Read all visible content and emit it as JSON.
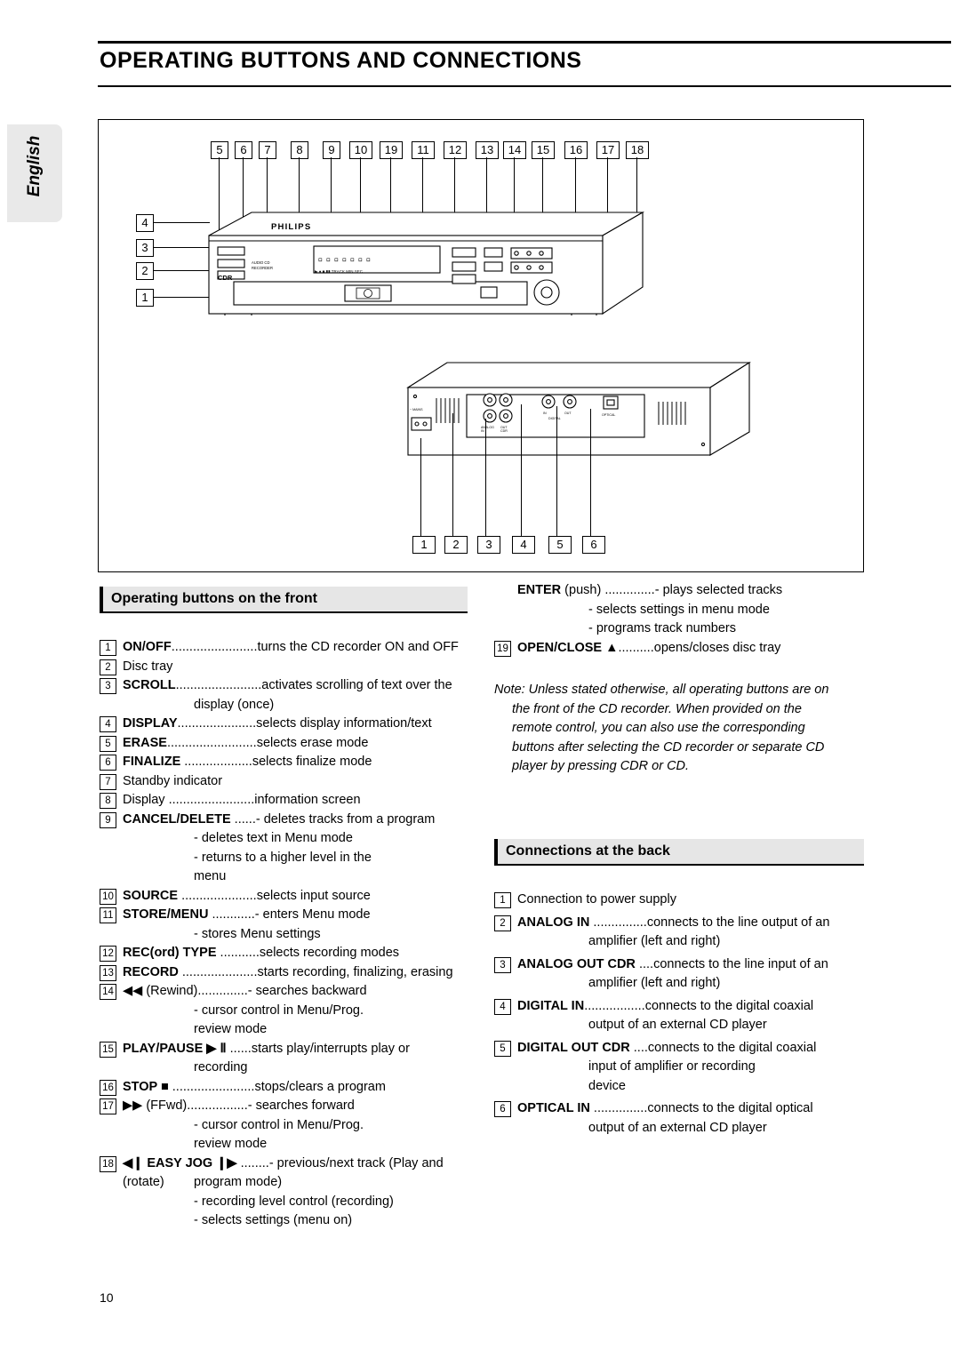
{
  "page": {
    "title": "OPERATING BUTTONS AND CONNECTIONS",
    "language_tab": "English",
    "page_number": "10"
  },
  "figure": {
    "top_callouts": [
      "5",
      "6",
      "7",
      "8",
      "9",
      "10",
      "19",
      "11",
      "12",
      "13",
      "14",
      "15",
      "16",
      "17",
      "18"
    ],
    "left_callouts": [
      "4",
      "3",
      "2",
      "1"
    ],
    "bottom_callouts": [
      "1",
      "2",
      "3",
      "4",
      "5",
      "6"
    ],
    "brand": "PHILIPS",
    "device_label": "CDR",
    "device_sub": "AUDIO CD RECORDER",
    "disc_logo": "COMPACT disc",
    "rear_labels": {
      "mains": "~ MAINS",
      "analog_in": "ANALOG IN",
      "analog_out": "ANALOG OUT CDR",
      "digital": "DIGITAL",
      "optical": "OPTICAL"
    }
  },
  "sections": {
    "front": "Operating buttons on the front",
    "back": "Connections at the back"
  },
  "front_items": [
    {
      "num": "1",
      "label": "ON/OFF",
      "dots": "........................",
      "desc": "turns the CD recorder ON and OFF",
      "subs": []
    },
    {
      "num": "2",
      "label": "",
      "dots": "",
      "desc": "Disc tray",
      "subs": []
    },
    {
      "num": "3",
      "label": "SCROLL",
      "dots": "........................",
      "desc": "activates scrolling of text over the",
      "subs": [
        "display (once)"
      ]
    },
    {
      "num": "4",
      "label": "DISPLAY",
      "dots": "......................",
      "desc": "selects display information/text",
      "subs": []
    },
    {
      "num": "5",
      "label": "ERASE",
      "dots": ".........................",
      "desc": "selects erase mode",
      "subs": []
    },
    {
      "num": "6",
      "label": "FINALIZE",
      "dots": "  ...................",
      "desc": "selects finalize mode",
      "subs": []
    },
    {
      "num": "7",
      "label": "",
      "dots": "",
      "desc": "Standby indicator",
      "subs": []
    },
    {
      "num": "8",
      "label": "",
      "dots": "",
      "desc": "Display ........................information screen",
      "subs": []
    },
    {
      "num": "9",
      "label": "CANCEL/DELETE",
      "dots": "  ......",
      "desc": "- deletes tracks from a program",
      "subs": [
        "- deletes text in Menu mode",
        "- returns to a higher level in the",
        "menu"
      ]
    },
    {
      "num": "10",
      "label": "SOURCE",
      "dots": "  .....................",
      "desc": "selects input source",
      "subs": []
    },
    {
      "num": "11",
      "label": "STORE/MENU",
      "dots": "  ............",
      "desc": "- enters Menu mode",
      "subs": [
        "- stores Menu settings"
      ]
    },
    {
      "num": "12",
      "label": "REC(ord) TYPE",
      "dots": "  ...........",
      "desc": "selects recording modes",
      "subs": []
    },
    {
      "num": "13",
      "label": "RECORD",
      "dots": "  .....................",
      "desc": "starts recording, finalizing, erasing",
      "subs": []
    },
    {
      "num": "14",
      "label": "◀◀ (Rewind)",
      "dots": "..............",
      "desc": "- searches backward",
      "subs": [
        "- cursor control in Menu/Prog.",
        "review mode"
      ]
    },
    {
      "num": "15",
      "label": "PLAY/PAUSE ▶ Ⅱ",
      "dots": "  ......",
      "desc": "starts play/interrupts play or",
      "subs": [
        "recording"
      ]
    },
    {
      "num": "16",
      "label": "STOP ■",
      "dots": "  .......................",
      "desc": "stops/clears a program",
      "subs": []
    },
    {
      "num": "17",
      "label": "▶▶ (FFwd)",
      "dots": ".................",
      "desc": "- searches forward",
      "subs": [
        "- cursor control in Menu/Prog.",
        "review mode"
      ]
    },
    {
      "num": "18",
      "label": "◀❙ EASY JOG ❙▶",
      "dots": "  ........",
      "desc": "- previous/next track (Play and",
      "subs": [
        "(rotate)",
        "program mode)",
        "- recording level control (recording)",
        "- selects settings (menu on)"
      ]
    }
  ],
  "front_items_right": [
    {
      "num": "",
      "label": "ENTER",
      "plain": " (push) ..............",
      "desc": "- plays selected tracks",
      "subs": [
        "- selects settings in menu mode",
        "- programs track numbers"
      ]
    },
    {
      "num": "19",
      "label": "OPEN/CLOSE ▲",
      "dots": "..........",
      "desc": "opens/closes disc tray",
      "subs": []
    }
  ],
  "note": {
    "line1": "Note: Unless stated otherwise, all operating buttons are on",
    "lines": [
      "the front of the CD recorder. When provided on the",
      "remote control, you can also use the corresponding",
      "buttons after selecting the CD recorder or separate CD",
      "player by pressing CDR or CD."
    ]
  },
  "back_items": [
    {
      "num": "1",
      "label": "",
      "dots": "",
      "desc": "Connection to power supply",
      "subs": []
    },
    {
      "num": "2",
      "label": "ANALOG IN",
      "dots": " ...............",
      "desc": "connects to the line output of an",
      "subs": [
        "amplifier (left and right)"
      ]
    },
    {
      "num": "3",
      "label": "ANALOG OUT CDR",
      "dots": " ....",
      "desc": "connects to the line input of an",
      "subs": [
        "amplifier (left and right)"
      ]
    },
    {
      "num": "4",
      "label": "DIGITAL IN",
      "dots": ".................",
      "desc": "connects to the digital coaxial",
      "subs": [
        "output of an external CD player"
      ]
    },
    {
      "num": "5",
      "label": "DIGITAL OUT CDR",
      "dots": " ....",
      "desc": "connects to the digital coaxial",
      "subs": [
        "input of amplifier or recording",
        "device"
      ]
    },
    {
      "num": "6",
      "label": "OPTICAL IN",
      "dots": " ...............",
      "desc": "connects to the digital optical",
      "subs": [
        "output of an external CD player"
      ]
    }
  ]
}
